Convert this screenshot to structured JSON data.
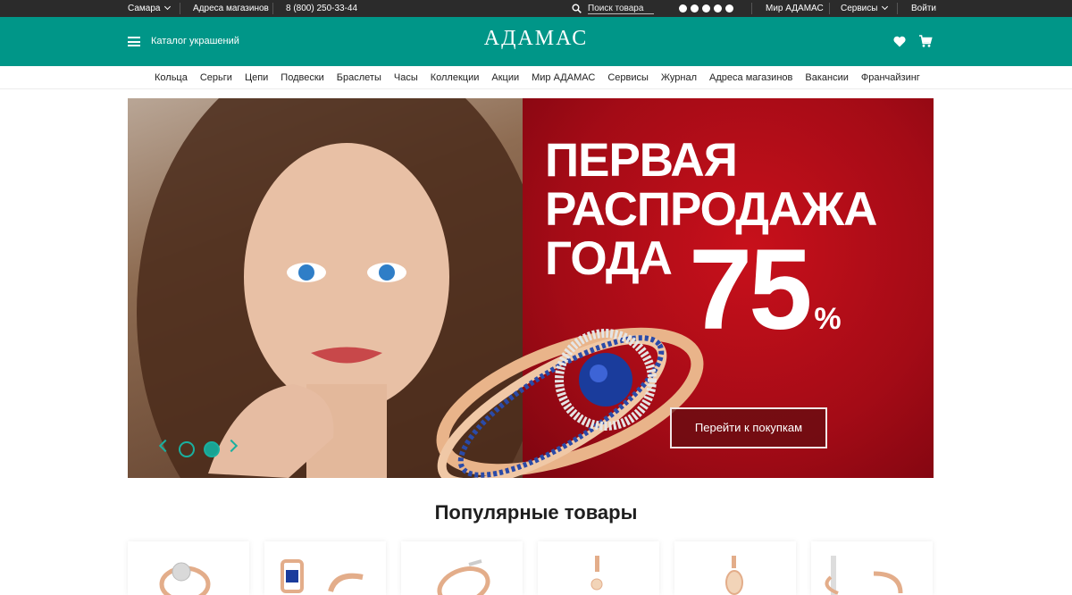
{
  "topbar": {
    "city": "Самара",
    "stores": "Адреса магазинов",
    "phone": "8 (800) 250-33-44",
    "search_placeholder": "Поиск товара",
    "world": "Мир АДАМАС",
    "services": "Сервисы",
    "login": "Войти"
  },
  "header": {
    "catalog": "Каталог украшений",
    "logo": "АДАМАС"
  },
  "nav": [
    "Кольца",
    "Серьги",
    "Цепи",
    "Подвески",
    "Браслеты",
    "Часы",
    "Коллекции",
    "Акции",
    "Мир АДАМАС",
    "Сервисы",
    "Журнал",
    "Адреса магазинов",
    "Вакансии",
    "Франчайзинг"
  ],
  "banner": {
    "line1": "ПЕРВАЯ",
    "line2": "РАСПРОДАЖА",
    "line3": "ГОДА",
    "discount": "75",
    "percent": "%",
    "cta": "Перейти к покупкам"
  },
  "popular": {
    "title": "Популярные товары"
  },
  "colors": {
    "brand": "#009688",
    "topbar": "#2b2b2b",
    "banner_red": "#b30c18"
  }
}
